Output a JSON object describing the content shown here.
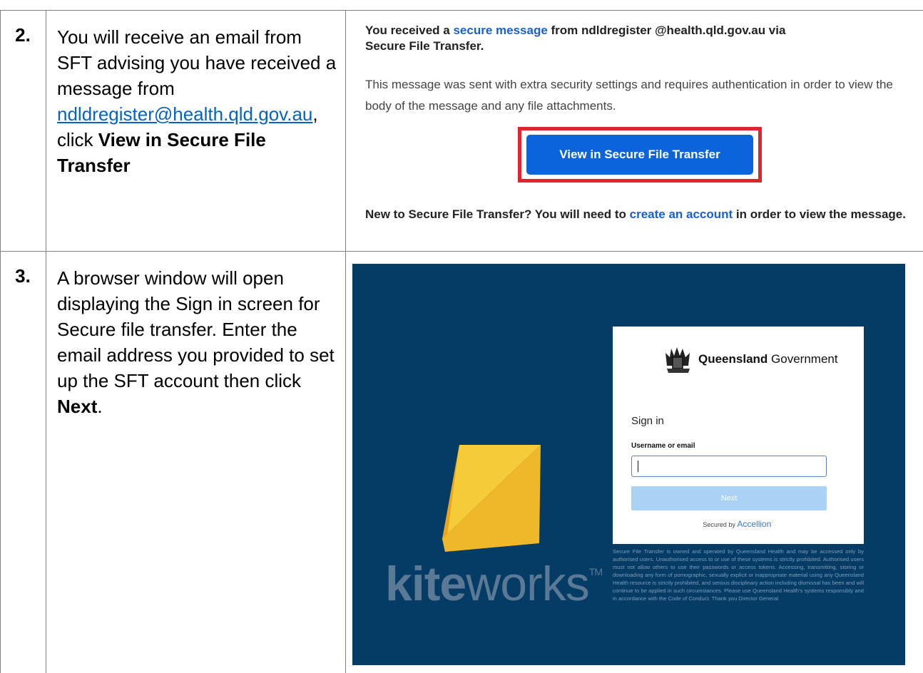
{
  "rows": [
    {
      "number": "2.",
      "text_before_link": "You will receive an email from SFT advising you have received a message from ",
      "link": "ndldregister@health.qld.gov.au",
      "text_after_link": ", click ",
      "action": "View in Secure File Transfer"
    },
    {
      "number": "3.",
      "text": "A browser window will open displaying the Sign in screen for Secure file transfer. Enter the email address you provided to set up the SFT account then click ",
      "action": "Next",
      "text_end": "."
    }
  ],
  "email": {
    "headline_start": "You received a ",
    "headline_link": "secure message",
    "headline_mid": " from  ndldregister @health.qld.gov.au via",
    "headline_end": "Secure File Transfer.",
    "body": "This message was sent with extra security settings and requires authentication in order to view the body of the message and any file attachments.",
    "cta_label": "View in Secure File Transfer",
    "footer_start": "New to Secure File Transfer? You will need to ",
    "footer_link": "create an account",
    "footer_end": " in order to view the message.",
    "colors": {
      "cta": "#0c64dc",
      "highlight": "#e1232b",
      "link": "#1a5fd0"
    }
  },
  "signin": {
    "brand_bold": "Queensland",
    "brand_rest": " Government",
    "title": "Sign in",
    "field_label": "Username or email",
    "username_value": "",
    "next_label": "Next",
    "secured_prefix": "Secured by ",
    "secured_brand": "Accellion",
    "legal": "Secure File Transfer is owned and operated by Queensland Health and may be accessed only by authorised users. Unauthorised access to or use of these systems is strictly prohibited. Authorised users must not allow others to use their passwords or access tokens. Accessing, transmitting, storing or downloading any form of pornographic, sexually explicit or inappropriate material using any Queensland Health resource is strictly prohibited, and serious disciplinary action including dismissal has been and will continue to be applied in such circumstances. Please use Queensland Health's systems responsibly and in accordance with the Code of Conduct. Thank you Director General",
    "logo_bold": "kite",
    "logo_rest": "works",
    "logo_mark": "TM",
    "colors": {
      "background": "#043c66",
      "kite_yellow": "#f2b929",
      "next": "#a9d2f4"
    }
  }
}
